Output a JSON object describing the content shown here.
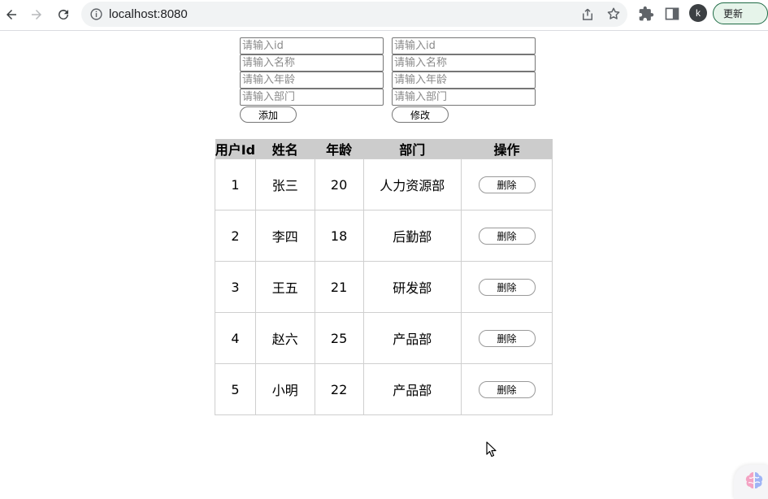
{
  "browser": {
    "url": "localhost:8080",
    "profile_initial": "k",
    "update_label": "更新"
  },
  "add_form": {
    "id_placeholder": "请输入id",
    "name_placeholder": "请输入名称",
    "age_placeholder": "请输入年龄",
    "dept_placeholder": "请输入部门",
    "submit_label": "添加"
  },
  "edit_form": {
    "id_placeholder": "请输入id",
    "name_placeholder": "请输入名称",
    "age_placeholder": "请输入年龄",
    "dept_placeholder": "请输入部门",
    "submit_label": "修改"
  },
  "table": {
    "headers": [
      "用户Id",
      "姓名",
      "年龄",
      "部门",
      "操作"
    ],
    "delete_label": "删除",
    "rows": [
      {
        "id": "1",
        "name": "张三",
        "age": "20",
        "dept": "人力资源部"
      },
      {
        "id": "2",
        "name": "李四",
        "age": "18",
        "dept": "后勤部"
      },
      {
        "id": "3",
        "name": "王五",
        "age": "21",
        "dept": "研发部"
      },
      {
        "id": "4",
        "name": "赵六",
        "age": "25",
        "dept": "产品部"
      },
      {
        "id": "5",
        "name": "小明",
        "age": "22",
        "dept": "产品部"
      }
    ]
  }
}
